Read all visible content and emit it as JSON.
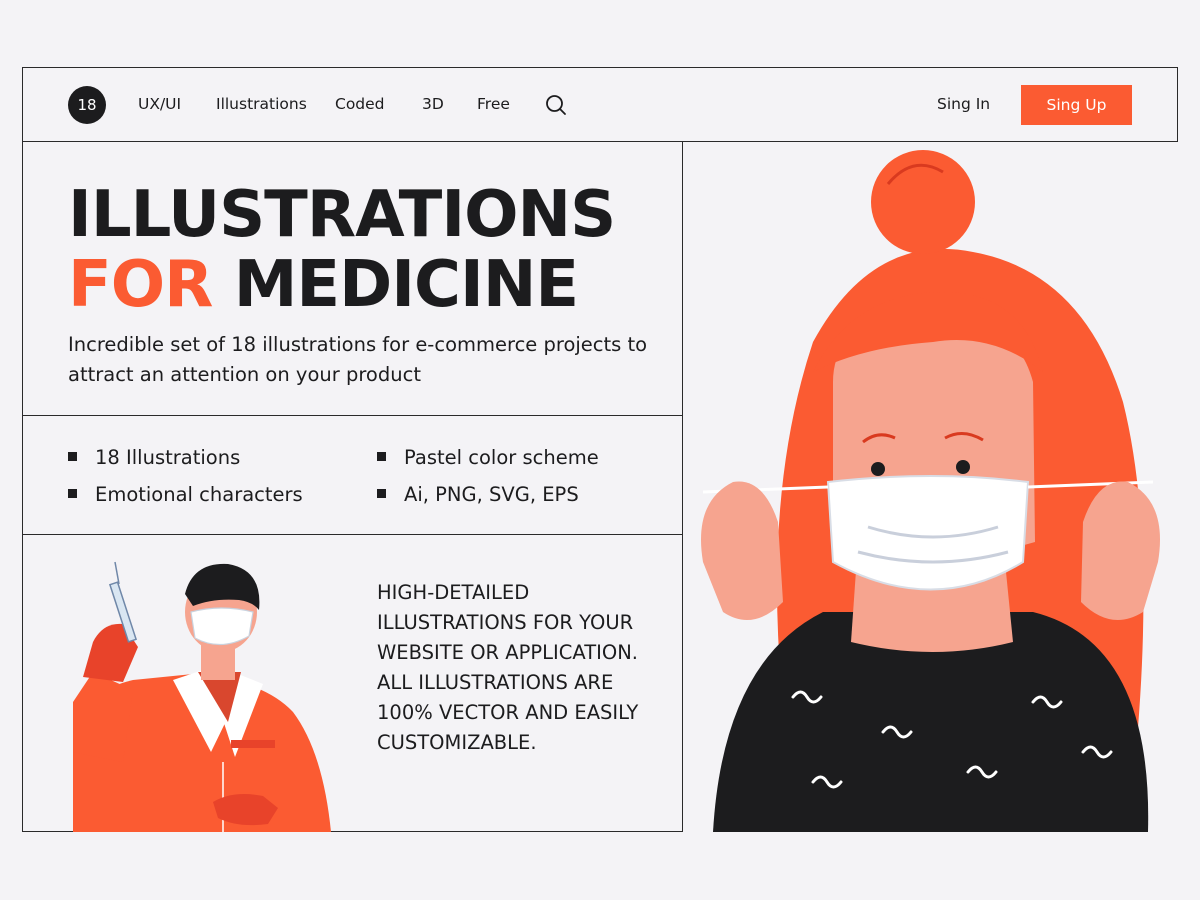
{
  "nav": {
    "logo_text": "18",
    "links": [
      "UX/UI",
      "Illustrations",
      "Coded",
      "3D",
      "Free"
    ],
    "signin_label": "Sing In",
    "signup_label": "Sing Up",
    "search_icon": "search-icon"
  },
  "hero": {
    "title_line1": "ILLUSTRATIONS",
    "title_accent": "FOR",
    "title_rest": "MEDICINE",
    "subtitle": "Incredible set of 18 illustrations for e-commerce projects to attract an attention on your product"
  },
  "features": [
    "18 Illustrations",
    "Emotional characters",
    "Pastel color scheme",
    "Ai, PNG, SVG, EPS"
  ],
  "detail_text": "HIGH-DETAILED ILLUSTRATIONS FOR YOUR WEBSITE OR APPLICATION. ALL ILLUSTRATIONS ARE 100% VECTOR AND EASILY CUSTOMIZABLE.",
  "colors": {
    "accent": "#fb5b32",
    "text": "#1c1c1e",
    "background": "#f4f3f6",
    "skin": "#f6a48f"
  }
}
